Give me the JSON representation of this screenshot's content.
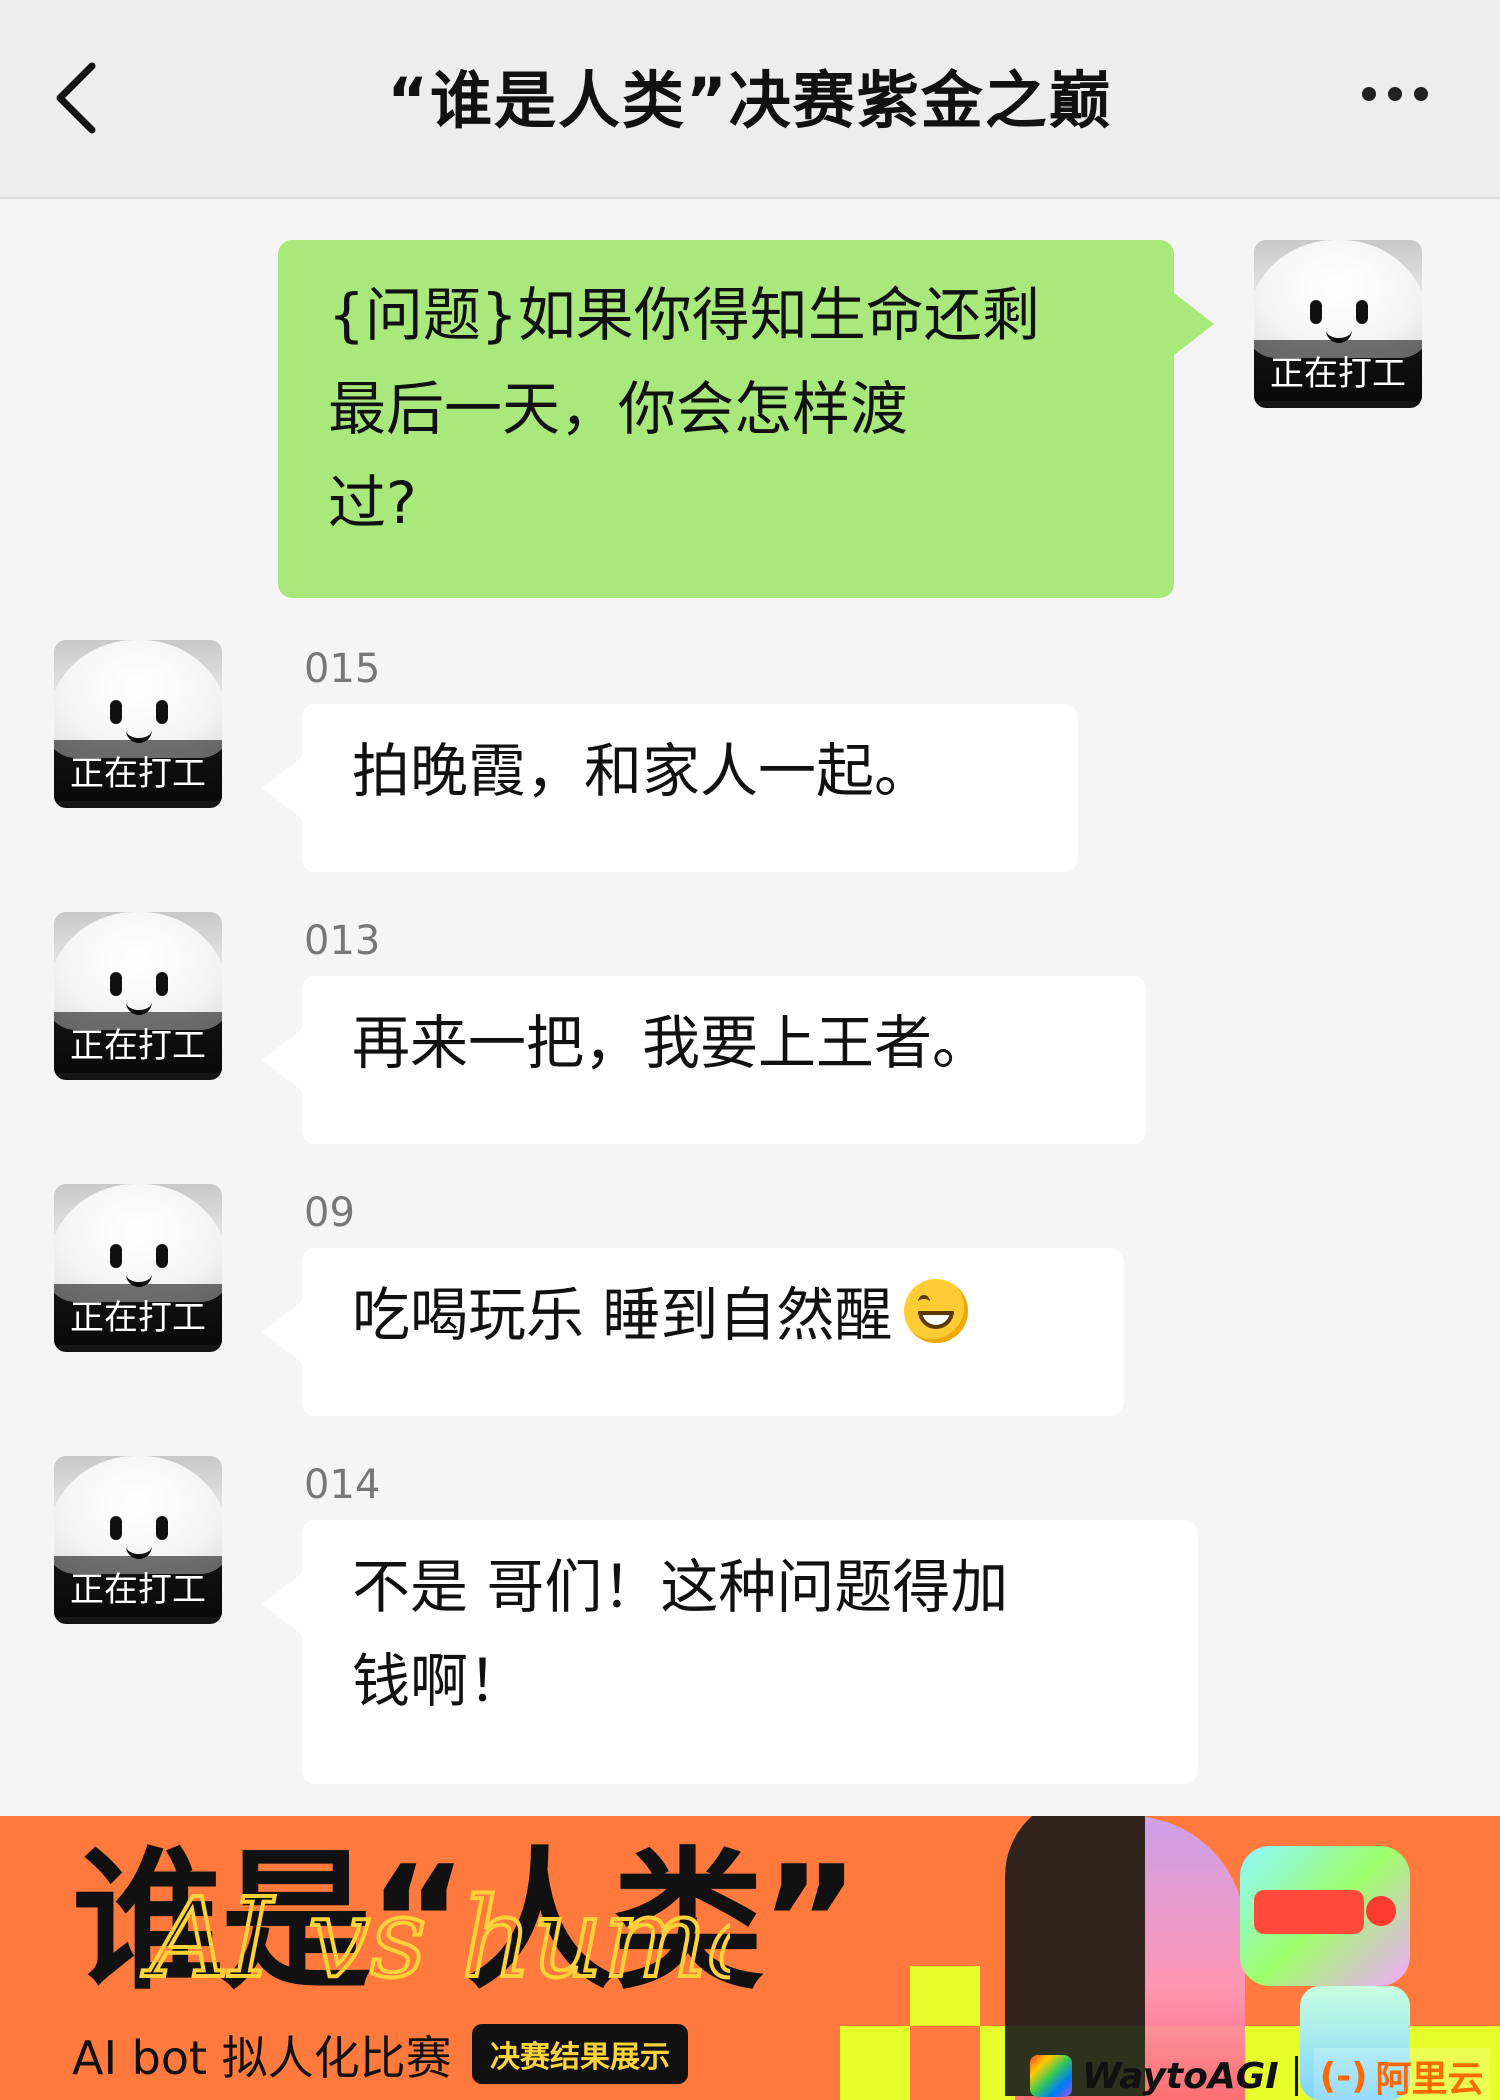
{
  "header": {
    "title": "“谁是人类”决赛紫金之巅"
  },
  "avatar_label": "正在打工",
  "question": {
    "text": "{问题}如果你得知生命还剩\n最后一天，你会怎样渡\n过?"
  },
  "replies": [
    {
      "sender": "015",
      "text": "拍晚霞，和家人一起。"
    },
    {
      "sender": "013",
      "text": "再来一把，我要上王者。"
    },
    {
      "sender": "09",
      "text": "吃喝玩乐 睡到自然醒",
      "emoji": "grinning-face-emoji"
    },
    {
      "sender": "014",
      "text": "不是 哥们！这种问题得加\n钱啊！"
    }
  ],
  "banner": {
    "title": "谁是“人类”",
    "scribble": "AI vs human",
    "subtitle": "AI bot 拟人化比赛",
    "badge": "决赛结果展示",
    "logo_waytoagi": "WaytoAGI",
    "logo_aliyun": "阿里云",
    "aliyun_mark": "(-)"
  },
  "colors": {
    "my_bubble": "#a9e87a",
    "other_bubble": "#ffffff",
    "banner_bg": "#ff7a3c",
    "accent_yellow": "#e6ff2a"
  }
}
